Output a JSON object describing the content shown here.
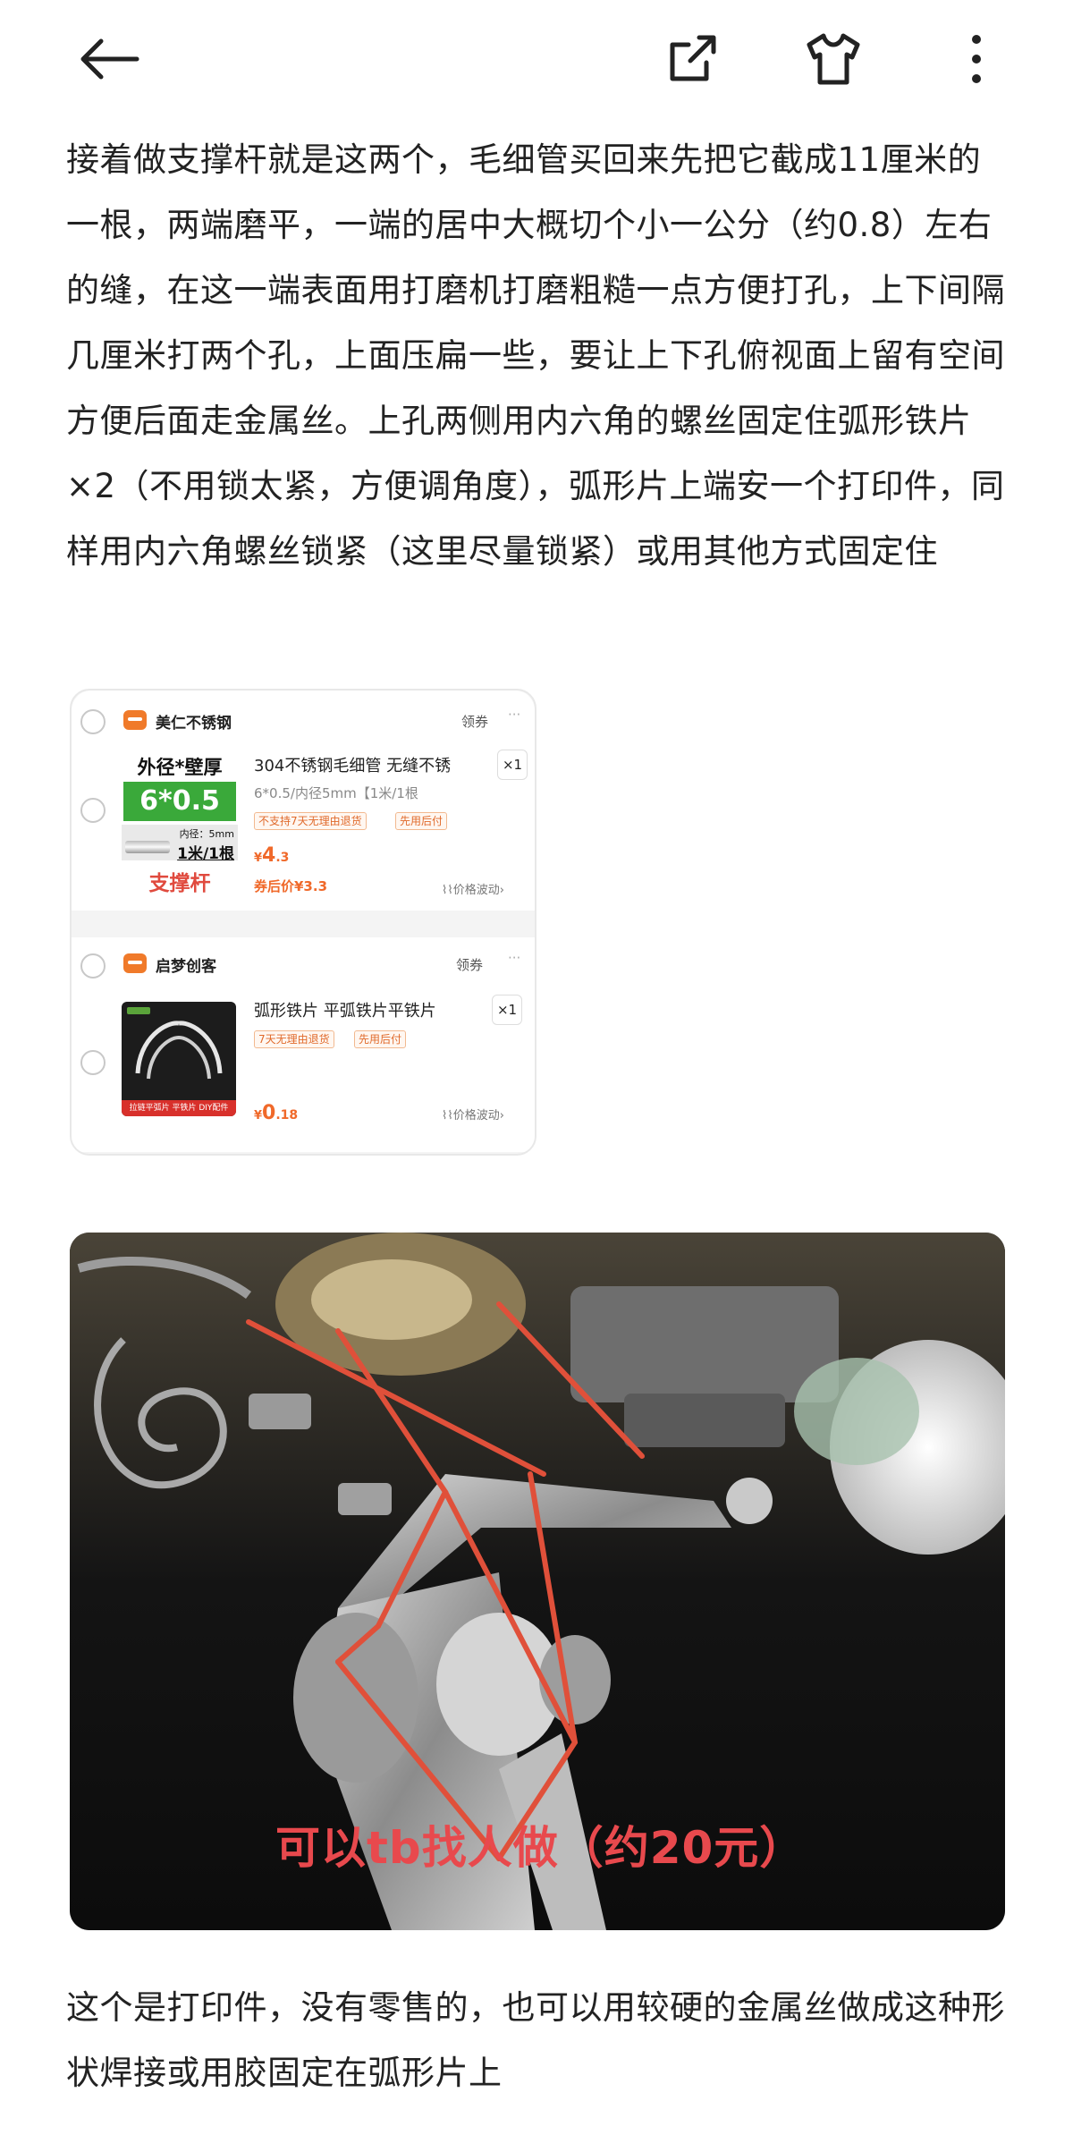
{
  "header": {
    "back_icon": "arrow-left-icon",
    "share_icon": "external-link-icon",
    "shirt_icon": "tshirt-icon",
    "more_icon": "vertical-dots-icon"
  },
  "article": {
    "paragraph1": "接着做支撑杆就是这两个，毛细管买回来先把它截成11厘米的一根，两端磨平，一端的居中大概切个小一公分（约0.8）左右的缝，在这一端表面用打磨机打磨粗糙一点方便打孔，上下间隔几厘米打两个孔，上面压扁一些，要让上下孔俯视面上留有空间方便后面走金属丝。上孔两侧用内六角的螺丝固定住弧形铁片×2（不用锁太紧，方便调角度），弧形片上端安一个打印件，同样用内六角螺丝锁紧（这里尽量锁紧）或用其他方式固定住",
    "paragraph2": "这个是打印件，没有零售的，也可以用较硬的金属丝做成这种形状焊接或用胶固定在弧形片上"
  },
  "cart": {
    "shops": [
      {
        "name": "美仁不锈钢",
        "coupon": "领券",
        "product": {
          "title": "304不锈钢毛细管 无缝不锈",
          "spec": "6*0.5/内径5mm【1米/1根",
          "tags": [
            "不支持7天无理由退货",
            "先用后付"
          ],
          "qty": "×1",
          "price_symbol": "¥",
          "price_int": "4",
          "price_dec": ".3",
          "after_coupon": "券后价¥3.3",
          "price_wave": "价格波动",
          "thumb": {
            "line1": "外径*壁厚",
            "line2": "6*0.5",
            "line3": "内径：5mm",
            "line4": "1米/1根",
            "line5": "支撑杆"
          }
        }
      },
      {
        "name": "启梦创客",
        "coupon": "领券",
        "product": {
          "title": "弧形铁片 平弧铁片平铁片",
          "tags": [
            "7天无理由退货",
            "先用后付"
          ],
          "qty": "×1",
          "price_symbol": "¥",
          "price_int": "0",
          "price_dec": ".18",
          "price_wave": "价格波动",
          "thumb": {
            "caption": "拉链平弧片 平铁片 DIY配件"
          }
        }
      }
    ]
  },
  "photo": {
    "overlay_text": "可以tb找人做（约20元）"
  }
}
